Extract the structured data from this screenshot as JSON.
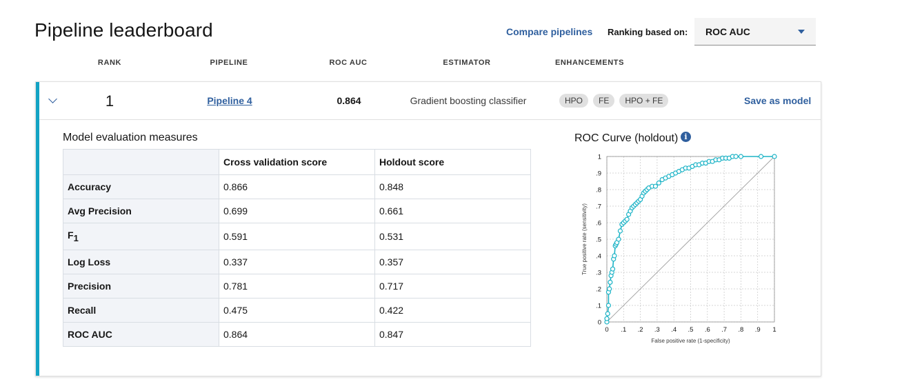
{
  "header": {
    "title": "Pipeline leaderboard",
    "compare_label": "Compare pipelines",
    "ranking_label": "Ranking based on:",
    "ranking_value": "ROC AUC"
  },
  "columns": [
    "RANK",
    "PIPELINE",
    "ROC AUC",
    "ESTIMATOR",
    "ENHANCEMENTS"
  ],
  "row": {
    "rank": "1",
    "pipeline": "Pipeline 4",
    "roc_auc": "0.864",
    "estimator": "Gradient boosting classifier",
    "enhancements": [
      "HPO",
      "FE",
      "HPO + FE"
    ],
    "save_label": "Save as model"
  },
  "evaluation": {
    "title": "Model evaluation measures",
    "headers": [
      "",
      "Cross validation score",
      "Holdout score"
    ],
    "rows": [
      {
        "metric": "Accuracy",
        "cv": "0.866",
        "holdout": "0.848"
      },
      {
        "metric": "Avg Precision",
        "cv": "0.699",
        "holdout": "0.661"
      },
      {
        "metric": "F",
        "metric_sub": "1",
        "cv": "0.591",
        "holdout": "0.531"
      },
      {
        "metric": "Log Loss",
        "cv": "0.337",
        "holdout": "0.357"
      },
      {
        "metric": "Precision",
        "cv": "0.781",
        "holdout": "0.717"
      },
      {
        "metric": "Recall",
        "cv": "0.475",
        "holdout": "0.422"
      },
      {
        "metric": "ROC AUC",
        "cv": "0.864",
        "holdout": "0.847"
      }
    ]
  },
  "colors": {
    "accent": "#13a3c4",
    "link": "#2f5f9e",
    "curve": "#1bb3c6",
    "diagonal": "#9e9e9e"
  },
  "chart_data": {
    "type": "line",
    "title": "ROC Curve (holdout)",
    "xlabel": "False positive rate (1-specificity)",
    "ylabel": "True positive rate (sensitivity)",
    "xlim": [
      0,
      1
    ],
    "ylim": [
      0,
      1
    ],
    "grid": true,
    "x_ticks": [
      "0",
      ".1",
      ".2",
      ".3",
      ".4",
      ".5",
      ".6",
      ".7",
      ".8",
      ".9",
      "1"
    ],
    "y_ticks": [
      "0",
      ".1",
      ".2",
      ".3",
      ".4",
      ".5",
      ".6",
      ".7",
      ".8",
      ".9",
      "1"
    ],
    "series": [
      {
        "x": [
          0,
          0,
          0.005,
          0.01,
          0.01,
          0.015,
          0.02,
          0.025,
          0.03,
          0.035,
          0.04,
          0.045,
          0.05,
          0.055,
          0.06,
          0.07,
          0.08,
          0.09,
          0.1,
          0.11,
          0.12,
          0.13,
          0.14,
          0.15,
          0.16,
          0.17,
          0.18,
          0.19,
          0.2,
          0.21,
          0.22,
          0.23,
          0.24,
          0.25,
          0.27,
          0.29,
          0.31,
          0.33,
          0.35,
          0.37,
          0.39,
          0.41,
          0.43,
          0.45,
          0.47,
          0.49,
          0.51,
          0.53,
          0.55,
          0.57,
          0.59,
          0.61,
          0.63,
          0.65,
          0.67,
          0.69,
          0.71,
          0.73,
          0.75,
          0.77,
          0.8,
          0.92,
          1.0
        ],
        "y": [
          0,
          0.02,
          0.05,
          0.1,
          0.18,
          0.2,
          0.24,
          0.28,
          0.3,
          0.32,
          0.38,
          0.4,
          0.46,
          0.47,
          0.48,
          0.5,
          0.55,
          0.59,
          0.6,
          0.61,
          0.62,
          0.65,
          0.67,
          0.69,
          0.7,
          0.71,
          0.72,
          0.73,
          0.74,
          0.76,
          0.78,
          0.79,
          0.8,
          0.81,
          0.82,
          0.82,
          0.84,
          0.86,
          0.87,
          0.88,
          0.89,
          0.9,
          0.91,
          0.92,
          0.93,
          0.93,
          0.94,
          0.95,
          0.95,
          0.96,
          0.96,
          0.97,
          0.97,
          0.98,
          0.98,
          0.99,
          0.99,
          0.99,
          1.0,
          1.0,
          1.0,
          1.0,
          1.0
        ]
      }
    ]
  }
}
